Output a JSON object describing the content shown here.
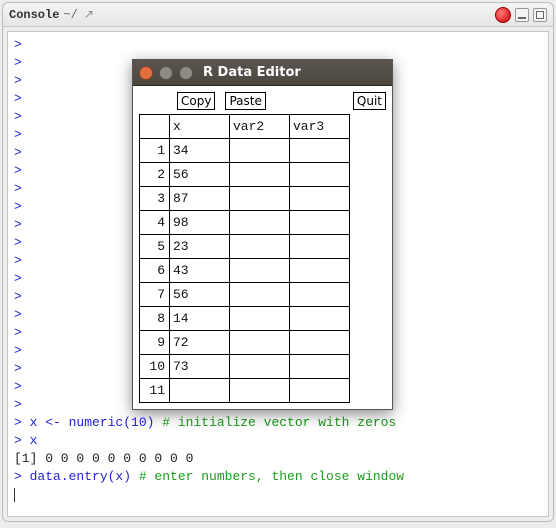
{
  "header": {
    "title": "Console",
    "path": "~/",
    "popout_icon": "↗"
  },
  "console_lines": [
    {
      "type": "prompt",
      "text": ">"
    },
    {
      "type": "prompt",
      "text": ">"
    },
    {
      "type": "prompt",
      "text": ">"
    },
    {
      "type": "prompt",
      "text": ">"
    },
    {
      "type": "prompt",
      "text": ">"
    },
    {
      "type": "prompt",
      "text": ">"
    },
    {
      "type": "prompt",
      "text": ">"
    },
    {
      "type": "prompt",
      "text": ">"
    },
    {
      "type": "prompt",
      "text": ">"
    },
    {
      "type": "prompt",
      "text": ">"
    },
    {
      "type": "prompt",
      "text": ">"
    },
    {
      "type": "prompt",
      "text": ">"
    },
    {
      "type": "prompt",
      "text": ">"
    },
    {
      "type": "prompt",
      "text": ">"
    },
    {
      "type": "prompt",
      "text": ">"
    },
    {
      "type": "prompt",
      "text": ">"
    },
    {
      "type": "prompt",
      "text": ">"
    },
    {
      "type": "prompt",
      "text": ">"
    },
    {
      "type": "prompt",
      "text": ">"
    },
    {
      "type": "prompt",
      "text": ">"
    },
    {
      "type": "prompt",
      "text": ">"
    },
    {
      "type": "code",
      "prompt": "> ",
      "body": "x <- numeric(10) ",
      "comment": "# initialize vector with zeros"
    },
    {
      "type": "code",
      "prompt": "> ",
      "body": "x",
      "comment": ""
    },
    {
      "type": "output",
      "text": "[1] 0 0 0 0 0 0 0 0 0 0"
    },
    {
      "type": "code",
      "prompt": "> ",
      "body": "data.entry(x) ",
      "comment": "# enter numbers, then close window"
    }
  ],
  "editor": {
    "title": "R Data Editor",
    "buttons": {
      "copy": "Copy",
      "paste": "Paste",
      "quit": "Quit"
    },
    "columns": [
      "x",
      "var2",
      "var3"
    ],
    "rows": [
      {
        "n": "1",
        "x": "34",
        "var2": "",
        "var3": ""
      },
      {
        "n": "2",
        "x": "56",
        "var2": "",
        "var3": ""
      },
      {
        "n": "3",
        "x": "87",
        "var2": "",
        "var3": ""
      },
      {
        "n": "4",
        "x": "98",
        "var2": "",
        "var3": ""
      },
      {
        "n": "5",
        "x": "23",
        "var2": "",
        "var3": ""
      },
      {
        "n": "6",
        "x": "43",
        "var2": "",
        "var3": ""
      },
      {
        "n": "7",
        "x": "56",
        "var2": "",
        "var3": ""
      },
      {
        "n": "8",
        "x": "14",
        "var2": "",
        "var3": ""
      },
      {
        "n": "9",
        "x": "72",
        "var2": "",
        "var3": ""
      },
      {
        "n": "10",
        "x": "73",
        "var2": "",
        "var3": ""
      },
      {
        "n": "11",
        "x": "",
        "var2": "",
        "var3": ""
      }
    ]
  }
}
